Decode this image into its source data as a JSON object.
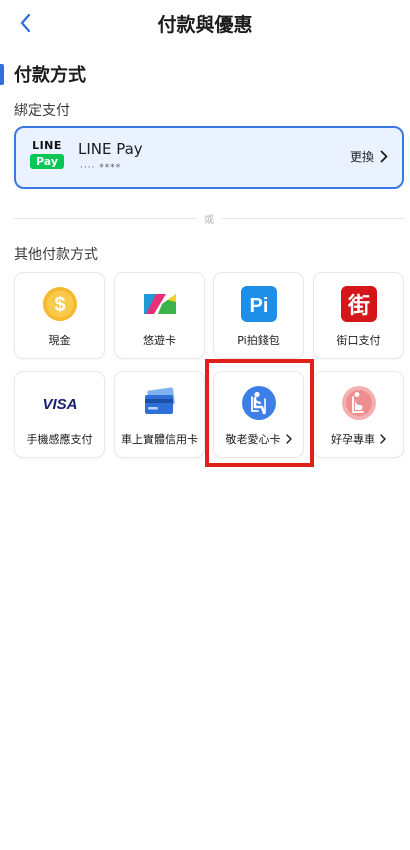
{
  "header": {
    "title": "付款與優惠",
    "back_icon": "chevron-left-icon"
  },
  "payment_section": {
    "title": "付款方式",
    "bound_label": "綁定支付",
    "bound_card": {
      "logo_line1": "LINE",
      "logo_line2": "Pay",
      "name": "LINE Pay",
      "masked_number": "···· ****",
      "change_label": "更換"
    },
    "divider_text": "或",
    "other_label": "其他付款方式",
    "methods": [
      {
        "label": "現金",
        "icon": "cash-coin-icon"
      },
      {
        "label": "悠遊卡",
        "icon": "easycard-icon"
      },
      {
        "label": "Pi拍錢包",
        "icon": "pi-wallet-icon"
      },
      {
        "label": "街口支付",
        "icon": "jkopay-icon"
      },
      {
        "label": "手機感應支付",
        "icon": "visa-icon",
        "icon_text": "VISA"
      },
      {
        "label": "車上實體信用卡",
        "icon": "credit-card-icon"
      },
      {
        "label": "敬老愛心卡",
        "icon": "senior-seat-icon",
        "has_chevron": true,
        "highlighted": true
      },
      {
        "label": "好孕專車",
        "icon": "pregnant-seat-icon",
        "has_chevron": true
      }
    ],
    "pi_icon_text": "Pi",
    "jko_icon_text": "街",
    "cash_icon_text": "$"
  },
  "colors": {
    "accent": "#2f6fe0",
    "card_bg": "#eaf2ff",
    "highlight": "#e0201b",
    "line_green": "#06c755"
  }
}
